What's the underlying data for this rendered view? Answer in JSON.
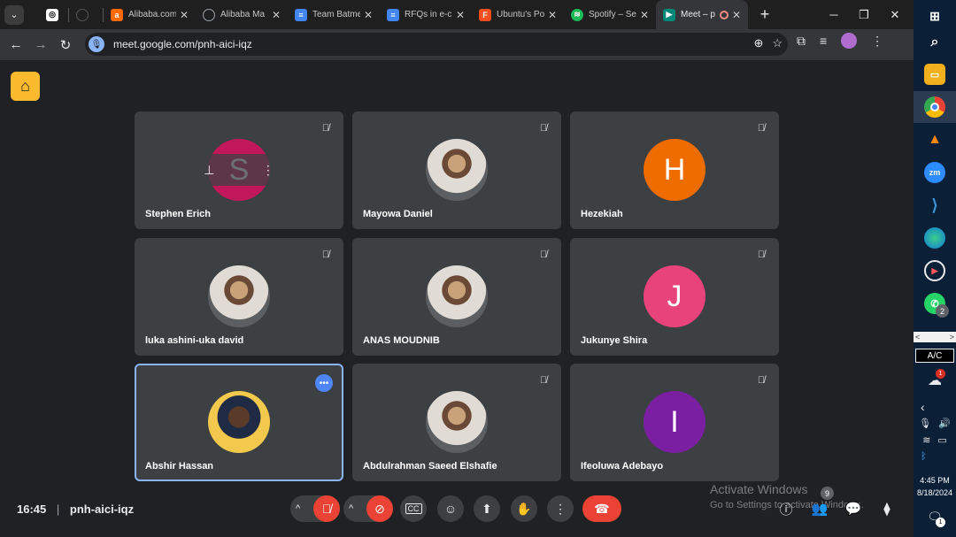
{
  "browser": {
    "tabs": [
      {
        "title": "",
        "icon": "chatgpt-icon",
        "color": "#ffffff"
      },
      {
        "title": "",
        "icon": "github-icon",
        "color": "#9aa0a6"
      },
      {
        "title": "Alibaba.com",
        "icon": "alibaba-icon",
        "color": "#ff6a00"
      },
      {
        "title": "Alibaba Ma",
        "icon": "globe-icon",
        "color": "#9aa0a6"
      },
      {
        "title": "Team Batme",
        "icon": "docs-icon",
        "color": "#4285f4"
      },
      {
        "title": "RFQs in e-c",
        "icon": "docs-icon",
        "color": "#4285f4"
      },
      {
        "title": "Ubuntu's Po",
        "icon": "figma-icon",
        "color": "#f24e1e"
      },
      {
        "title": "Spotify – Se",
        "icon": "spotify-icon",
        "color": "#1db954"
      },
      {
        "title": "Meet – p",
        "icon": "meet-icon",
        "color": "#00897b"
      }
    ],
    "url": "meet.google.com/pnh-aici-iqz"
  },
  "meet": {
    "participants": [
      {
        "name": "Stephen Erich",
        "initial": "S",
        "color": "#c2185b",
        "type": "initial"
      },
      {
        "name": "Mayowa Daniel",
        "initial": "",
        "color": "#6d6d6d",
        "type": "photo"
      },
      {
        "name": "Hezekiah",
        "initial": "H",
        "color": "#ef6c00",
        "type": "initial"
      },
      {
        "name": "luka ashini-uka david",
        "initial": "",
        "color": "#6d6d6d",
        "type": "photo"
      },
      {
        "name": "ANAS MOUDNIB",
        "initial": "",
        "color": "#6d6d6d",
        "type": "photo"
      },
      {
        "name": "Jukunye Shira",
        "initial": "J",
        "color": "#e8437a",
        "type": "initial"
      },
      {
        "name": "Abshir Hassan",
        "initial": "",
        "color": "#f2c94c",
        "type": "photo"
      },
      {
        "name": "Abdulrahman Saeed Elshafie",
        "initial": "",
        "color": "#6d6d6d",
        "type": "photo"
      },
      {
        "name": "Ifeoluwa Adebayo",
        "initial": "I",
        "color": "#7b1fa2",
        "type": "initial"
      }
    ],
    "time": "16:45",
    "meeting_code": "pnh-aici-iqz",
    "people_count": "9"
  },
  "watermark": {
    "line1": "Activate Windows",
    "line2": "Go to Settings to activate Windows."
  },
  "taskbar": {
    "whatsapp_badge": "2",
    "weather_badge": "1",
    "ac_label": "A/C",
    "time": "4:45 PM",
    "date": "8/18/2024",
    "notification_badge": "1"
  }
}
